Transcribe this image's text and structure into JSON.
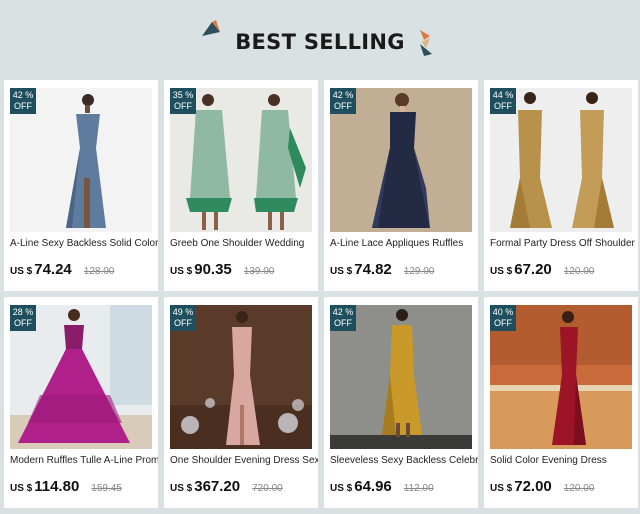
{
  "section_title": "BEST SELLING",
  "currency": "US $",
  "products": [
    {
      "discount": "42 %",
      "off": "OFF",
      "name": "A-Line Sexy Backless Solid Color",
      "price": "74.24",
      "original": "128.00",
      "image": "blue-slit-gown-image"
    },
    {
      "discount": "35 %",
      "off": "OFF",
      "name": "Greeb One Shoulder Wedding",
      "price": "90.35",
      "original": "139.00",
      "image": "green-feather-dress-image"
    },
    {
      "discount": "42 %",
      "off": "OFF",
      "name": "A-Line Lace Appliques Ruffles",
      "price": "74.82",
      "original": "129.00",
      "image": "navy-lace-dress-image"
    },
    {
      "discount": "44 %",
      "off": "OFF",
      "name": "Formal Party Dress Off  Shoulder",
      "price": "67.20",
      "original": "120.00",
      "image": "gold-mermaid-dress-image"
    },
    {
      "discount": "28 %",
      "off": "OFF",
      "name": "Modern Ruffles Tulle A-Line Prom",
      "price": "114.80",
      "original": "159.45",
      "image": "magenta-tulle-gown-image"
    },
    {
      "discount": "49 %",
      "off": "OFF",
      "name": "One Shoulder Evening Dress Sexy",
      "price": "367.20",
      "original": "720.00",
      "image": "pink-sequin-gown-image"
    },
    {
      "discount": "42 %",
      "off": "OFF",
      "name": "Sleeveless Sexy Backless Celebrity",
      "price": "64.96",
      "original": "112.00",
      "image": "gold-sequin-dress-image"
    },
    {
      "discount": "40 %",
      "off": "OFF",
      "name": "Solid Color Evening Dress",
      "price": "72.00",
      "original": "120.00",
      "image": "red-satin-gown-image"
    }
  ],
  "colors": {
    "page_bg": "#d9e1e3",
    "badge_bg": "#1f4f5e",
    "deco_dark": "#2d4f5c",
    "deco_orange": "#d97a3c"
  }
}
